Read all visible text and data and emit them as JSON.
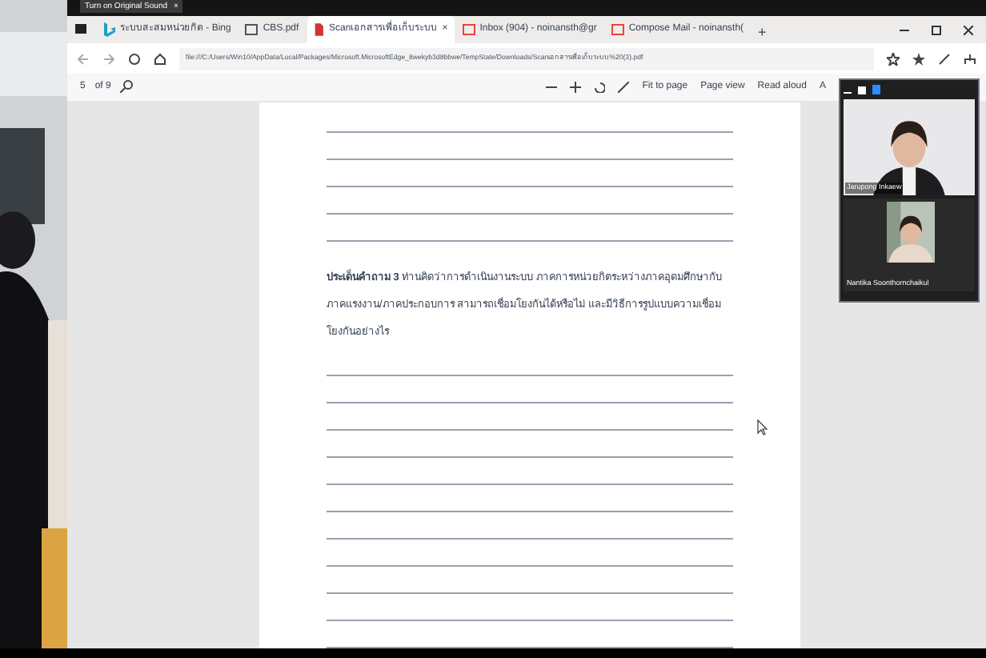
{
  "top_bar": {
    "tooltip": "Turn on Original Sound",
    "tooltip_close": "×"
  },
  "tabs": [
    {
      "label": "ระบบสะสมหน่วยกิต - Bing",
      "kind": "bing",
      "selected": false
    },
    {
      "label": "CBS.pdf",
      "kind": "page",
      "selected": false
    },
    {
      "label": "Scanเอกสารเพื่อเก็บระบบ",
      "kind": "pdf",
      "selected": true,
      "close": "×"
    },
    {
      "label": "Inbox (904) - noinansth@gr",
      "kind": "mail",
      "selected": false
    },
    {
      "label": "Compose Mail - noinansth(",
      "kind": "mail",
      "selected": false
    }
  ],
  "new_tab": "+",
  "address": "file:///C:/Users/Win10/AppData/Local/Packages/Microsoft.MicrosoftEdge_8wekyb3d8bbwe/TempState/Downloads/Scanเอกสารเพื่อเก็บระบบ%20(3).pdf",
  "pdf_toolbar": {
    "page": "5",
    "of": "of 9",
    "fit": "Fit to page",
    "view": "Page view",
    "read": "Read aloud",
    "more": "A"
  },
  "document": {
    "question": "**ประเด็นคำถาม 3** ท่านคิดว่าการดำเนินงานระบบ ภาคการหน่วยกิตระหว่างภาคอุดมศึกษากับภาคแรงงาน/ภาคประกอบการ สามารถเชื่อมโยงกันได้หรือไม่ และมีวิธีการรูปแบบความเชื่อมโยงกันอย่างไร"
  },
  "video_panel": {
    "participants": [
      {
        "name": "Jarupong Inkaew",
        "kind": "large"
      },
      {
        "name": "Nantika Soonthornchaikul",
        "kind": "small"
      }
    ]
  }
}
